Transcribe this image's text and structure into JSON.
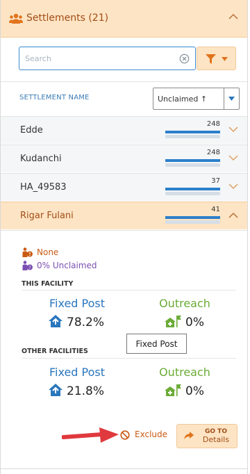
{
  "header": {
    "title": "Settlements (21)"
  },
  "search": {
    "placeholder": "Search",
    "value": ""
  },
  "list": {
    "column_header": "SETTLEMENT NAME",
    "sort_value": "Unclaimed ↑",
    "max_count": 248,
    "rows": [
      {
        "name": "Edde",
        "count": "248",
        "fraction": 1.0
      },
      {
        "name": "Kudanchi",
        "count": "248",
        "fraction": 1.0
      },
      {
        "name": "HA_49583",
        "count": "37",
        "fraction": 1.0
      },
      {
        "name": "Rigar Fulani",
        "count": "41",
        "fraction": 1.0
      }
    ]
  },
  "details": {
    "legend": [
      {
        "icon": "person-alert-icon",
        "text": "None",
        "color": "#c95a13"
      },
      {
        "icon": "person-question-icon",
        "text": "0% Unclaimed",
        "color": "#7c4fb2"
      }
    ],
    "this_facility": {
      "label": "THIS FACILITY",
      "fixed_post": {
        "label": "Fixed Post",
        "value": "78.2%"
      },
      "outreach": {
        "label": "Outreach",
        "value": "0%"
      }
    },
    "other_facilities": {
      "label": "OTHER FACILITIES",
      "fixed_post": {
        "label": "Fixed Post",
        "value": "21.8%"
      },
      "outreach": {
        "label": "Outreach",
        "value": "0%"
      }
    },
    "tooltip": "Fixed Post",
    "exclude_label": "Exclude",
    "goto": {
      "line1": "GO TO",
      "line2": "Details"
    }
  },
  "colors": {
    "accent_orange": "#c95a13",
    "header_bg": "#fde4c4",
    "fixed_post_blue": "#2a76bd",
    "outreach_green": "#6aab36",
    "bar_blue": "#2b7fcb",
    "annotation_red": "#e0393e"
  }
}
